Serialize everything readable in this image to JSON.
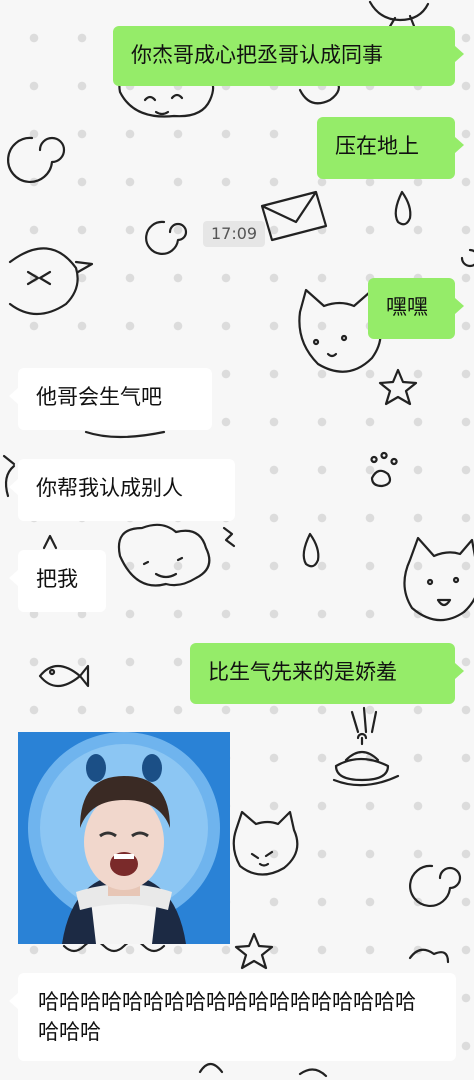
{
  "timestamp": "17:09",
  "messages": [
    {
      "side": "right",
      "text": "你杰哥成心把丞哥认成同事"
    },
    {
      "side": "right",
      "text": "压在地上"
    },
    {
      "side": "right",
      "text": "嘿嘿"
    },
    {
      "side": "left",
      "text": "他哥会生气吧"
    },
    {
      "side": "left",
      "text": "你帮我认成别人"
    },
    {
      "side": "left",
      "text": "把我"
    },
    {
      "side": "right",
      "text": "比生气先来的是娇羞"
    },
    {
      "side": "left",
      "type": "sticker",
      "icon": "laughing-boy-sticker"
    },
    {
      "side": "left",
      "text": "哈哈哈哈哈哈哈哈哈哈哈哈哈哈哈哈哈哈哈哈哈"
    }
  ],
  "colors": {
    "sent_bubble": "#95ec69",
    "received_bubble": "#ffffff",
    "background": "#f7f7f7"
  }
}
